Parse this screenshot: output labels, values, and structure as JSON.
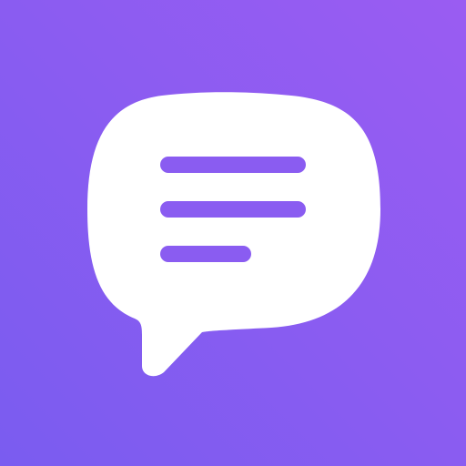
{
  "icon": {
    "name": "chat-bubble-icon",
    "colors": {
      "background_start": "#7a5cf0",
      "background_end": "#9a5cf2",
      "bubble": "#ffffff",
      "lines": "#8a5cf1"
    }
  }
}
